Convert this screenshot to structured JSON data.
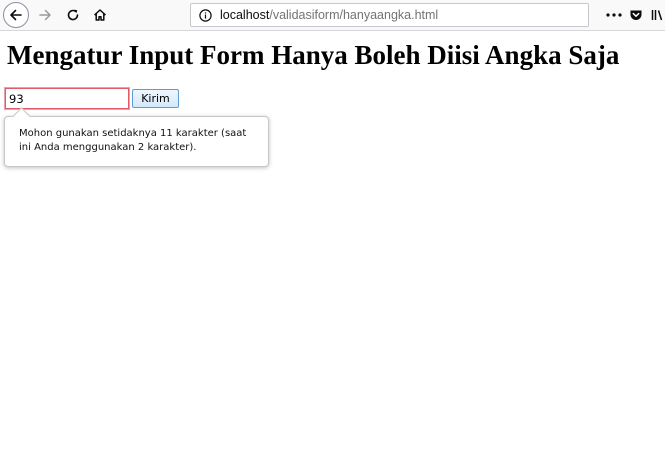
{
  "browser": {
    "url_host": "localhost",
    "url_path": "/validasiform/hanyaangka.html",
    "icons": {
      "back": "arrow-left-icon",
      "forward": "arrow-right-icon",
      "reload": "reload-icon",
      "home": "home-icon",
      "info": "info-icon",
      "more": "more-icon",
      "pocket": "pocket-icon",
      "library": "library-icon"
    }
  },
  "page": {
    "title": "Mengatur Input Form Hanya Boleh Diisi Angka Saja",
    "input_value": "93",
    "submit_label": "Kirim",
    "validation_message": "Mohon gunakan setidaknya 11 karakter (saat ini Anda menggunakan 2 karakter).",
    "invalid_color": "#e05a67"
  }
}
